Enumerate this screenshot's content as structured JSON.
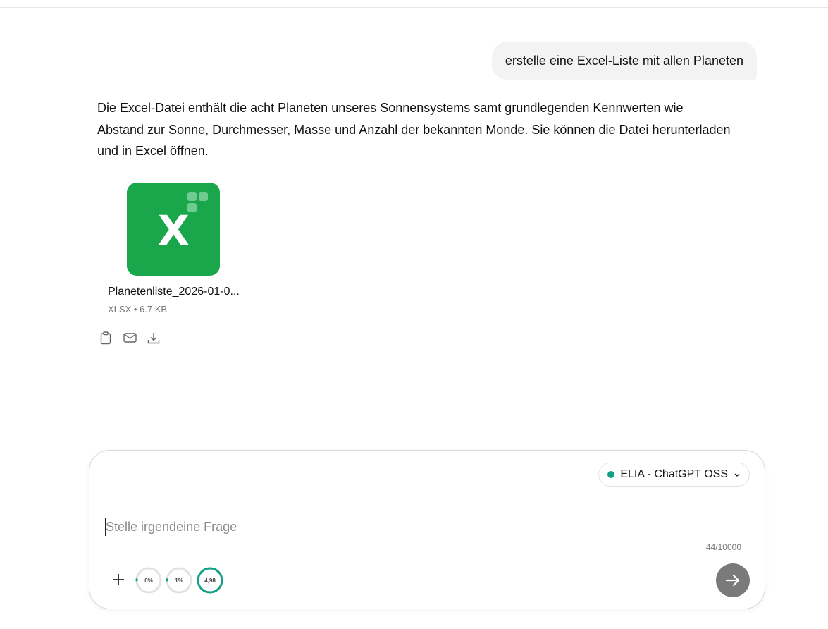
{
  "chat": {
    "user_message": "erstelle eine Excel-Liste mit allen Planeten",
    "assistant_message": "Die Excel-Datei enthält die acht Planeten unseres Sonnensystems samt grundlegenden Kennwerten wie Abstand zur Sonne, Durchmesser, Masse und Anzahl der bekannten Monde. Sie können die Datei herunterladen und in Excel öffnen.",
    "attachment": {
      "icon_letter": "X",
      "name": "Planetenliste_2026-01-0...",
      "meta": "XLSX • 6.7 KB",
      "icon_color": "#1aa64a"
    },
    "message_actions": [
      {
        "icon": "clipboard-icon"
      },
      {
        "icon": "mail-icon"
      },
      {
        "icon": "download-icon"
      }
    ]
  },
  "composer": {
    "model": "ELIA - ChatGPT OSS",
    "model_status_color": "#13a085",
    "placeholder": "Stelle irgendeine Frage",
    "value": "",
    "counter": "44/10000",
    "gauges": [
      {
        "label": "0%",
        "fraction": 0.0
      },
      {
        "label": "1%",
        "fraction": 0.01
      },
      {
        "label": "4,98",
        "fraction": 1.0
      }
    ],
    "accent_color": "#13a085"
  }
}
